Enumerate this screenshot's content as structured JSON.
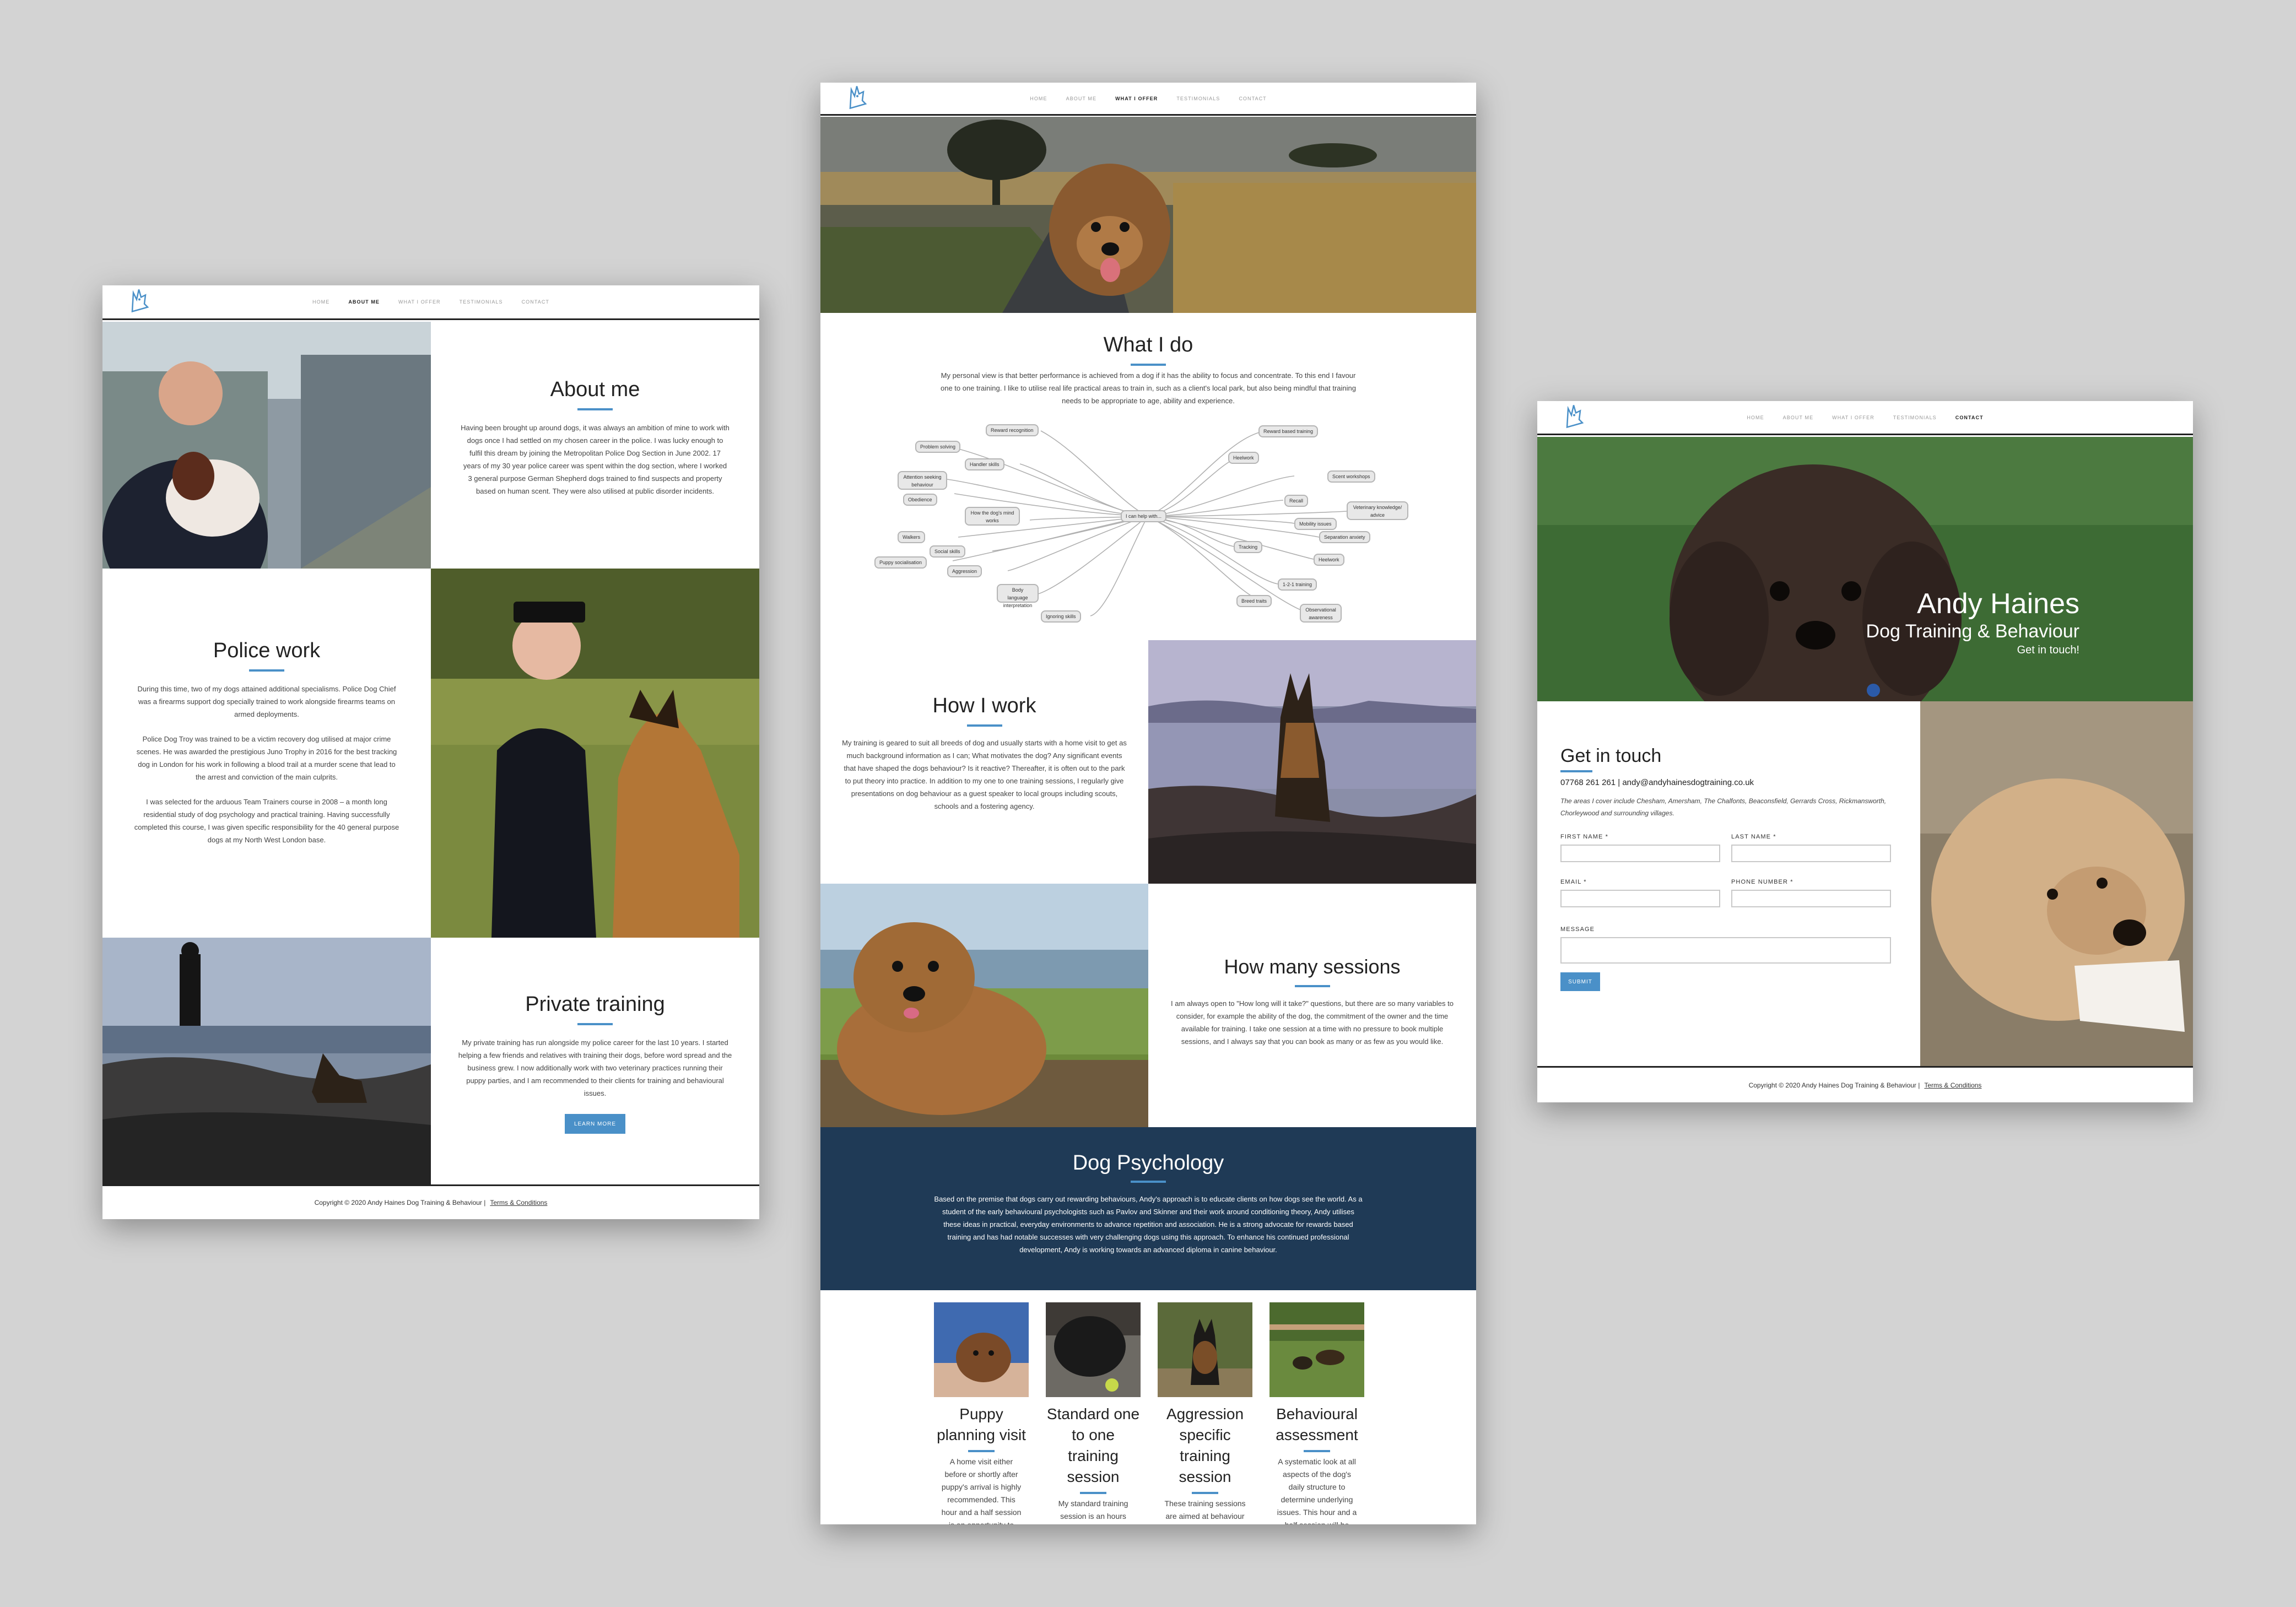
{
  "colors": {
    "accent": "#4a90c8",
    "navy": "#1f3a56",
    "background": "#d3d3d3"
  },
  "nav_items": [
    "HOME",
    "ABOUT ME",
    "WHAT I OFFER",
    "TESTIMONIALS",
    "CONTACT"
  ],
  "logo_icon": "dog-logo-icon",
  "about_page": {
    "about": {
      "title": "About me",
      "text": "Having been brought up around dogs, it was always an ambition of mine to work with dogs once I had settled on my chosen career in the police. I was lucky enough to fulfil this dream by joining the Metropolitan Police Dog Section in June 2002. 17 years of my 30 year police career was spent within the dog section, where I worked 3 general purpose German Shepherd dogs trained to find suspects and property based on human scent. They were also utilised at public disorder incidents."
    },
    "police": {
      "title": "Police work",
      "p1": "During this time, two of my dogs attained additional specialisms. Police Dog Chief was a firearms support dog specially trained to work alongside firearms teams on armed deployments.",
      "p2": "Police Dog Troy was trained to be a victim recovery dog utilised at major crime scenes. He was awarded the prestigious Juno Trophy in 2016 for the best tracking dog in London for his work in following a blood trail at a murder scene that lead to the arrest and conviction of the main culprits.",
      "p3": "I was selected for the arduous Team Trainers course in 2008 – a month long residential study of dog psychology and practical training. Having successfully completed this course, I was given specific responsibility for the 40 general purpose dogs at my North West London base."
    },
    "private": {
      "title": "Private training",
      "text": "My private training has run alongside my police career for the last 10 years. I started helping a few friends and relatives with training their dogs, before word spread and the business grew. I now additionally work with two veterinary practices running their puppy parties, and I am recommended to their clients for training and behavioural issues.",
      "button": "LEARN MORE"
    }
  },
  "offer_page": {
    "what": {
      "title": "What I do",
      "text": "My personal view is that better performance is achieved from a dog if it has the ability to focus and concentrate. To this end I favour one to one training. I like to utilise real life practical areas to train in, such as a client's local park, but also being mindful that training needs to be appropriate to age, ability and experience."
    },
    "mindmap": {
      "center": "I can help with...",
      "nodes": [
        "Reward recognition",
        "Problem solving",
        "Handler skills",
        "Attention seeking behaviour",
        "Obedience",
        "How the dog's mind works",
        "Walkers",
        "Social skills",
        "Puppy socialisation",
        "Aggression",
        "Body language interpretation",
        "Ignoring skills",
        "Reward based training",
        "Heelwork",
        "Scent workshops",
        "Recall",
        "Veterinary knowledge/ advice",
        "Mobility issues",
        "Separation anxiety",
        "Tracking",
        "Heelwork",
        "1-2-1 training",
        "Breed traits",
        "Observational awareness"
      ]
    },
    "how": {
      "title": "How I work",
      "text": "My training is geared to suit all breeds of dog and usually starts with a home visit to get as much background information as I can; What motivates the dog? Any significant events that have shaped the dogs behaviour? Is it reactive? Thereafter, it is often out to the park to put theory into practice. In addition to my one to one training sessions, I regularly give presentations on dog behaviour as a guest speaker to local groups including scouts, schools and a fostering agency."
    },
    "sessions": {
      "title": "How many sessions",
      "text": "I am always open to \"How long will it take?\" questions, but there are so many variables to consider, for example the ability of the dog, the commitment of the owner and the time available for training. I take one session at a time with no pressure to book multiple sessions, and I always say that you can book as many or as few as you would like."
    },
    "psych": {
      "title": "Dog Psychology",
      "text": "Based on the premise that dogs carry out rewarding behaviours, Andy's approach is to educate clients on how dogs see the world. As a student of the early behavioural psychologists such as Pavlov and Skinner and their work around conditioning theory, Andy utilises these ideas in practical, everyday environments to advance repetition and association. He is a strong advocate for rewards based training and has had notable successes with very challenging dogs using this approach. To enhance his continued professional development, Andy is working towards an advanced diploma in canine behaviour."
    },
    "cards": [
      {
        "title": "Puppy planning visit",
        "text": "A home visit either before or shortly after puppy's arrival is highly recommended. This hour and a half session is an opportunity to discuss"
      },
      {
        "title": "Standard one to one training session",
        "text": "My standard training session is an hours duration, usually at a"
      },
      {
        "title": "Aggression specific training session",
        "text": "These training sessions are aimed at behaviour modification specifically"
      },
      {
        "title": "Behavioural assessment",
        "text": "A systematic look at all aspects of the dog's daily structure to determine underlying issues. This hour and a half session will be followed up with"
      }
    ]
  },
  "contact_page": {
    "hero": {
      "name": "Andy Haines",
      "sub": "Dog Training & Behaviour",
      "cta": "Get in touch!"
    },
    "title": "Get in touch",
    "contact_line": "07768 261 261 | andy@andyhainesdogtraining.co.uk",
    "areas": "The areas I cover include Chesham, Amersham, The Chalfonts, Beaconsfield, Gerrards Cross, Rickmansworth, Chorleywood and surrounding villages.",
    "labels": {
      "first": "FIRST NAME *",
      "last": "LAST NAME *",
      "email": "EMAIL *",
      "phone": "PHONE NUMBER *",
      "message": "MESSAGE"
    },
    "submit": "SUBMIT"
  },
  "footer": {
    "copyright": "Copyright © 2020 Andy Haines Dog Training & Behaviour |",
    "terms": "Terms & Conditions"
  }
}
